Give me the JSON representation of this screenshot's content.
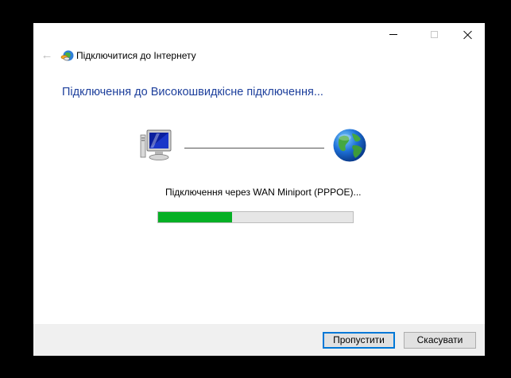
{
  "window": {
    "nav_title": "Підключитися до Інтернету",
    "heading": "Підключення до Високошвидкісне підключення..."
  },
  "status": {
    "text": "Підключення через WAN Miniport (PPPOE)...",
    "progress_fraction": 0.38,
    "progress_color": "#06b025"
  },
  "icons": {
    "back": "back-arrow-icon",
    "network": "network-connection-icon",
    "computer": "computer-icon",
    "globe": "globe-icon"
  },
  "buttons": {
    "skip_label": "Пропустити",
    "cancel_label": "Скасувати"
  },
  "colors": {
    "heading": "#1d3f9c",
    "accent_border": "#0078d7"
  }
}
